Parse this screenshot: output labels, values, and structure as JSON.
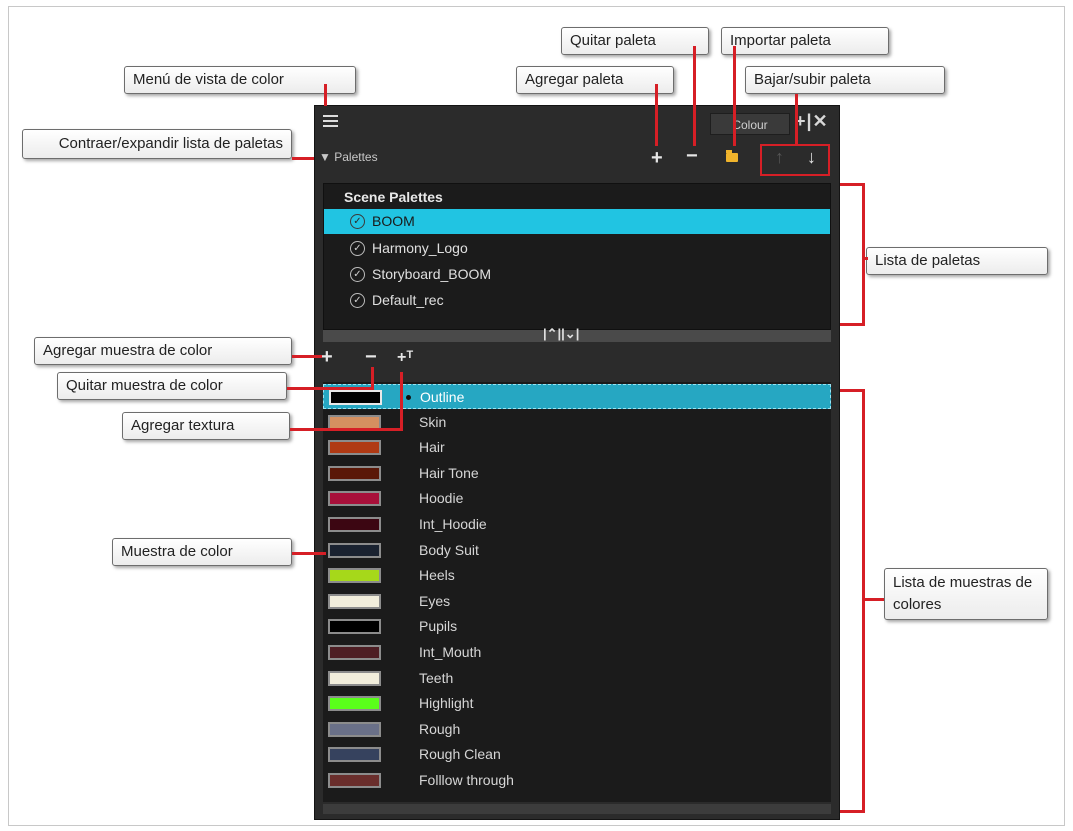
{
  "callouts": {
    "menu": "Menú de vista de color",
    "collapse": "Contraer/expandir lista de paletas",
    "add_palette": "Agregar paleta",
    "remove_palette": "Quitar paleta",
    "import_palette": "Importar paleta",
    "move_palette": "Bajar/subir paleta",
    "palette_list": "Lista de paletas",
    "add_swatch": "Agregar muestra de color",
    "remove_swatch": "Quitar muestra de color",
    "add_texture": "Agregar textura",
    "swatch": "Muestra de color",
    "swatch_list": "Lista de muestras de colores"
  },
  "panel": {
    "tab_label": "Colour",
    "palettes_header": "Palettes",
    "section_title": "Scene Palettes",
    "palettes": [
      {
        "name": "BOOM",
        "selected": true
      },
      {
        "name": "Harmony_Logo",
        "selected": false
      },
      {
        "name": "Storyboard_BOOM",
        "selected": false
      },
      {
        "name": "Default_rec",
        "selected": false
      }
    ],
    "swatches": [
      {
        "name": "Outline",
        "color": "#000000",
        "selected": true
      },
      {
        "name": "Skin",
        "color": "#d59060"
      },
      {
        "name": "Hair",
        "color": "#b03a14"
      },
      {
        "name": "Hair Tone",
        "color": "#5a1808"
      },
      {
        "name": "Hoodie",
        "color": "#a8103a"
      },
      {
        "name": "Int_Hoodie",
        "color": "#3c0612"
      },
      {
        "name": "Body Suit",
        "color": "#1a2230"
      },
      {
        "name": "Heels",
        "color": "#a6d81a"
      },
      {
        "name": "Eyes",
        "color": "#f2eedc"
      },
      {
        "name": "Pupils",
        "color": "#000000"
      },
      {
        "name": "Int_Mouth",
        "color": "#4e1e24"
      },
      {
        "name": "Teeth",
        "color": "#f2eedc"
      },
      {
        "name": "Highlight",
        "color": "#5aff1a"
      },
      {
        "name": "Rough",
        "color": "#6a7088"
      },
      {
        "name": "Rough Clean",
        "color": "#36425e"
      },
      {
        "name": "Folllow through",
        "color": "#6a2e2c"
      }
    ]
  },
  "colors": {
    "annotation": "#d61f26",
    "selection": "#21c4e2"
  }
}
